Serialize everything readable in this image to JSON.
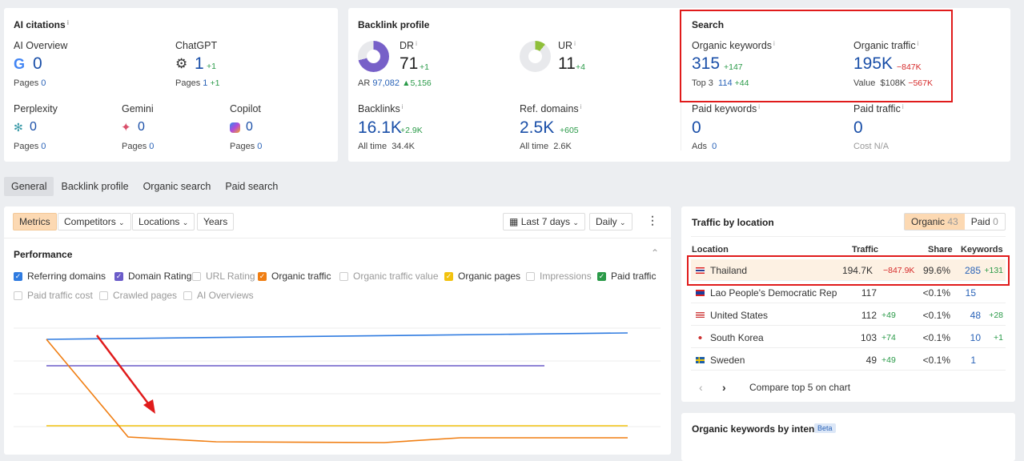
{
  "ai_citations": {
    "title": "AI citations",
    "ai_overview": {
      "label": "AI Overview",
      "value": "0",
      "pages_label": "Pages",
      "pages": "0",
      "icon": "google-icon"
    },
    "chatgpt": {
      "label": "ChatGPT",
      "value": "1",
      "delta": "+1",
      "pages_label": "Pages",
      "pages": "1",
      "pages_delta": "+1",
      "icon": "openai-icon"
    },
    "perplexity": {
      "label": "Perplexity",
      "value": "0",
      "pages_label": "Pages",
      "pages": "0",
      "icon": "perplexity-icon"
    },
    "gemini": {
      "label": "Gemini",
      "value": "0",
      "pages_label": "Pages",
      "pages": "0",
      "icon": "gemini-icon"
    },
    "copilot": {
      "label": "Copilot",
      "value": "0",
      "pages_label": "Pages",
      "pages": "0",
      "icon": "copilot-icon"
    }
  },
  "backlink_profile": {
    "title": "Backlink profile",
    "dr": {
      "label": "DR",
      "value": "71",
      "delta": "+1",
      "gauge_percent": 71
    },
    "ar": {
      "label": "AR",
      "value": "97,082",
      "delta": "5,156"
    },
    "ur": {
      "label": "UR",
      "value": "11",
      "delta": "+4",
      "gauge_percent": 11
    },
    "backlinks": {
      "label": "Backlinks",
      "value": "16.1K",
      "delta": "+2.9K",
      "all_time_label": "All time",
      "all_time": "34.4K"
    },
    "ref_domains": {
      "label": "Ref. domains",
      "value": "2.5K",
      "delta": "+605",
      "all_time_label": "All time",
      "all_time": "2.6K"
    }
  },
  "search": {
    "title": "Search",
    "organic_keywords": {
      "label": "Organic keywords",
      "value": "315",
      "delta": "+147",
      "sub_label": "Top 3",
      "sub": "114",
      "sub_delta": "+44"
    },
    "organic_traffic": {
      "label": "Organic traffic",
      "value": "195K",
      "delta": "−847K",
      "sub_label": "Value",
      "sub": "$108K",
      "sub_delta": "−567K"
    },
    "paid_keywords": {
      "label": "Paid keywords",
      "value": "0",
      "sub_label": "Ads",
      "sub": "0"
    },
    "paid_traffic": {
      "label": "Paid traffic",
      "value": "0",
      "sub_label": "Cost",
      "sub": "N/A"
    }
  },
  "tabs": [
    "General",
    "Backlink profile",
    "Organic search",
    "Paid search"
  ],
  "toolbar": {
    "metrics": "Metrics",
    "competitors": "Competitors",
    "locations": "Locations",
    "years": "Years",
    "range": "Last 7 days",
    "interval": "Daily"
  },
  "performance": {
    "title": "Performance",
    "checkboxes": [
      {
        "label": "Referring domains",
        "checked": true,
        "color": "#2f7be0"
      },
      {
        "label": "Domain Rating",
        "checked": true,
        "color": "#6b5cc9"
      },
      {
        "label": "URL Rating",
        "checked": false
      },
      {
        "label": "Organic traffic",
        "checked": true,
        "color": "#f07e12"
      },
      {
        "label": "Organic traffic value",
        "checked": false
      },
      {
        "label": "Organic pages",
        "checked": true,
        "color": "#f2c20f"
      },
      {
        "label": "Impressions",
        "checked": false
      },
      {
        "label": "Paid traffic",
        "checked": true,
        "color": "#2a9a48"
      },
      {
        "label": "Paid traffic cost",
        "checked": false
      },
      {
        "label": "Crawled pages",
        "checked": false
      },
      {
        "label": "AI Overviews",
        "checked": false
      }
    ]
  },
  "traffic_by_location": {
    "title": "Traffic by location",
    "organic_label": "Organic",
    "organic_count": "43",
    "paid_label": "Paid",
    "paid_count": "0",
    "headers": [
      "Location",
      "Traffic",
      "Share",
      "Keywords"
    ],
    "rows": [
      {
        "country": "Thailand",
        "traffic": "194.7K",
        "traffic_delta": "−847.9K",
        "share": "99.6%",
        "keywords": "285",
        "kw_delta": "+131"
      },
      {
        "country": "Lao People's Democratic Rep",
        "traffic": "117",
        "traffic_delta": "",
        "share": "<0.1%",
        "keywords": "15",
        "kw_delta": ""
      },
      {
        "country": "United States",
        "traffic": "112",
        "traffic_delta": "+49",
        "share": "<0.1%",
        "keywords": "48",
        "kw_delta": "+28"
      },
      {
        "country": "South Korea",
        "traffic": "103",
        "traffic_delta": "+74",
        "share": "<0.1%",
        "keywords": "10",
        "kw_delta": "+1"
      },
      {
        "country": "Sweden",
        "traffic": "49",
        "traffic_delta": "+49",
        "share": "<0.1%",
        "keywords": "1",
        "kw_delta": ""
      }
    ],
    "compare": "Compare top 5 on chart"
  },
  "intent": {
    "title": "Organic keywords by intent",
    "badge": "Beta"
  }
}
